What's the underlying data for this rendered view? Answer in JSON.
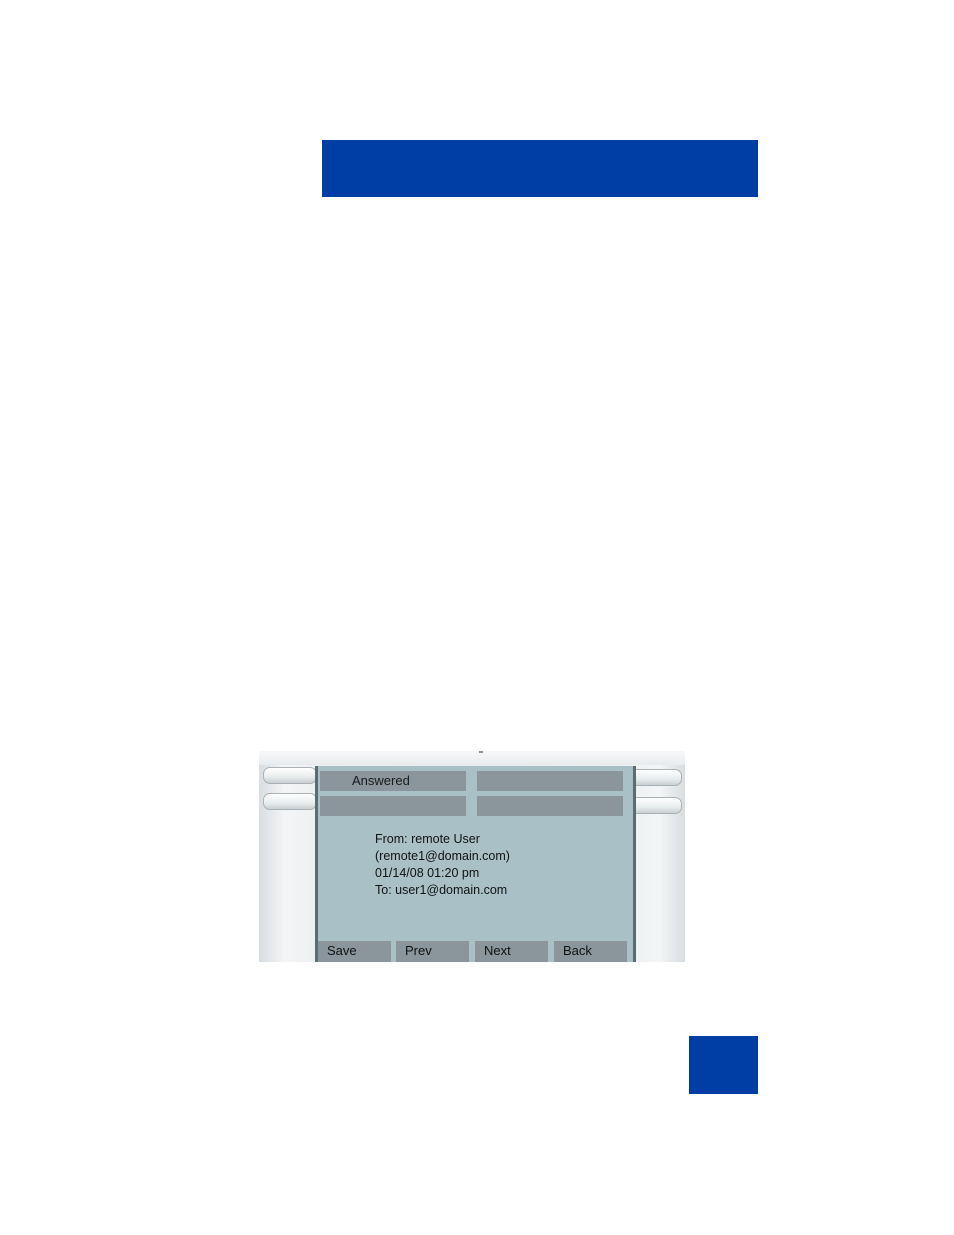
{
  "colors": {
    "brand_blue": "#003da5",
    "screen_bg": "#a9c1c6",
    "key_bg": "#8a969b"
  },
  "phone_screen": {
    "line_keys": [
      {
        "label": "Answered"
      },
      {
        "label": ""
      },
      {
        "label": ""
      },
      {
        "label": ""
      }
    ],
    "message": {
      "from": "From: remote User",
      "address": "(remote1@domain.com)",
      "datetime": "01/14/08 01:20 pm",
      "to": "To: user1@domain.com"
    },
    "soft_keys": {
      "save": "Save",
      "prev": "Prev",
      "next": "Next",
      "back": "Back"
    }
  }
}
